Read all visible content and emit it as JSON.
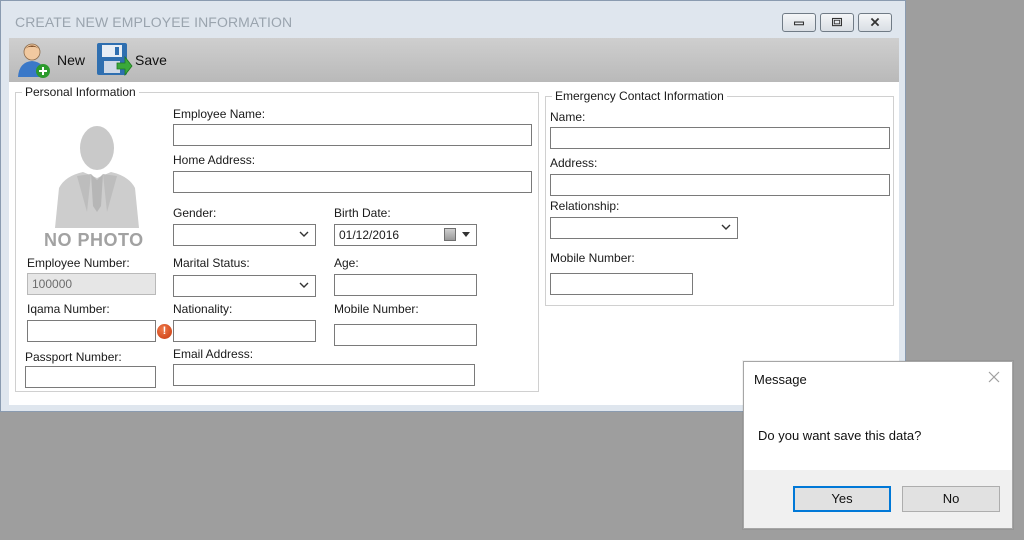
{
  "window": {
    "title": "CREATE NEW EMPLOYEE INFORMATION"
  },
  "toolbar": {
    "new_label": "New",
    "save_label": "Save"
  },
  "personal": {
    "legend": "Personal Information",
    "photo_text": "NO PHOTO",
    "employee_name_label": "Employee Name:",
    "employee_name_value": "",
    "home_address_label": "Home Address:",
    "home_address_value": "",
    "gender_label": "Gender:",
    "gender_value": "",
    "birth_date_label": "Birth Date:",
    "birth_date_value": "01/12/2016",
    "employee_number_label": "Employee Number:",
    "employee_number_value": "100000",
    "marital_status_label": "Marital Status:",
    "marital_status_value": "",
    "age_label": "Age:",
    "age_value": "",
    "iqama_label": "Iqama Number:",
    "iqama_value": "",
    "nationality_label": "Nationality:",
    "nationality_value": "",
    "mobile_label": "Mobile Number:",
    "mobile_value": "",
    "passport_label": "Passport Number:",
    "passport_value": "",
    "email_label": "Email Address:",
    "email_value": ""
  },
  "emergency": {
    "legend": "Emergency Contact Information",
    "name_label": "Name:",
    "name_value": "",
    "address_label": "Address:",
    "address_value": "",
    "relationship_label": "Relationship:",
    "relationship_value": "",
    "mobile_label": "Mobile Number:",
    "mobile_value": ""
  },
  "dialog": {
    "title": "Message",
    "message": "Do you want save this data?",
    "yes_label": "Yes",
    "no_label": "No"
  },
  "colors": {
    "window_bg": "#dfe6ee",
    "toolbar_bg": "#c4c4c4",
    "desktop_bg": "#9e9e9e",
    "dialog_primary_border": "#0078d7",
    "error_icon": "#d9471c"
  }
}
